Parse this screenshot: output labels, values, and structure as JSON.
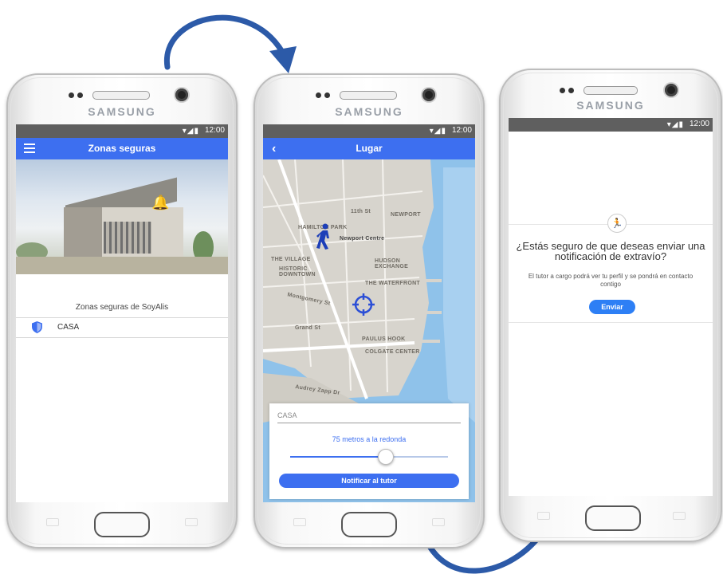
{
  "device_brand": "SAMSUNG",
  "status_bar": {
    "signal_icons": "▾◢▮",
    "time": "12:00"
  },
  "screen1": {
    "title": "Zonas seguras",
    "caption": "Zonas seguras de SoyAlis",
    "list_items": [
      {
        "label": "CASA"
      }
    ]
  },
  "screen2": {
    "title": "Lugar",
    "map_labels": {
      "street_11th": "11th St",
      "newport": "NEWPORT",
      "hamilton_park": "HAMILTON PARK",
      "newport_centre": "Newport Centre",
      "the_village": "THE VILLAGE",
      "historic_downtown": "HISTORIC DOWNTOWN",
      "hudson_exchange": "HUDSON EXCHANGE",
      "the_waterfront": "THE WATERFRONT",
      "montgomery": "Montgomery St",
      "grand_st": "Grand St",
      "paulus_hook": "PAULUS HOOK",
      "colgate_center": "COLGATE CENTER",
      "audrey_zapp": "Audrey Zapp Dr"
    },
    "place_value": "CASA",
    "radius_text": "75 metros a la redonda",
    "radius_fraction": 0.6,
    "notify_button": "Notificar al tutor"
  },
  "screen3": {
    "question": "¿Estás seguro de que deseas enviar una notificación de extravío?",
    "body": "El tutor a cargo podrá ver tu perfil y se pondrá en contacto contigo",
    "send_button": "Enviar"
  },
  "colors": {
    "accent": "#3d6ff0",
    "status_bar": "#5f5f5f",
    "arrow": "#2c5aa8"
  }
}
